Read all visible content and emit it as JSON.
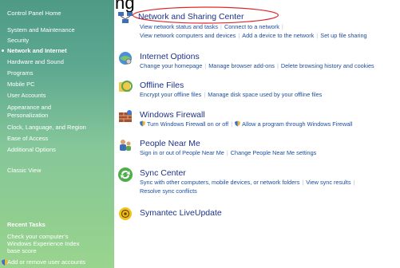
{
  "header": {
    "title": "ng"
  },
  "sidebar": {
    "items": [
      {
        "label": "Control Panel Home"
      },
      {
        "label": "System and Maintenance"
      },
      {
        "label": "Security"
      },
      {
        "label": "Network and Internet"
      },
      {
        "label": "Hardware and Sound"
      },
      {
        "label": "Programs"
      },
      {
        "label": "Mobile PC"
      },
      {
        "label": "User Accounts"
      },
      {
        "label": "Appearance and"
      },
      {
        "label": "Personalization"
      },
      {
        "label": "Clock, Language, and Region"
      },
      {
        "label": "Ease of Access"
      },
      {
        "label": "Additional Options"
      }
    ],
    "classic_view": "Classic View",
    "recent_tasks": {
      "heading": "Recent Tasks",
      "items": [
        {
          "label": "Check your computer's"
        },
        {
          "label": "Windows Experience Index"
        },
        {
          "label": "base score"
        },
        {
          "label": "Add or remove user accounts"
        }
      ]
    }
  },
  "categories": [
    {
      "title": "Network and Sharing Center",
      "icon": "network-icon",
      "links": [
        "View network status and tasks",
        "Connect to a network",
        "View network computers and devices",
        "Add a device to the network",
        "Set up file sharing"
      ]
    },
    {
      "title": "Internet Options",
      "icon": "internet-options-icon",
      "links": [
        "Change your homepage",
        "Manage browser add-ons",
        "Delete browsing history and cookies"
      ]
    },
    {
      "title": "Offline Files",
      "icon": "offline-files-icon",
      "links": [
        "Encrypt your offline files",
        "Manage disk space used by your offline files"
      ]
    },
    {
      "title": "Windows Firewall",
      "icon": "firewall-icon",
      "links": [
        "Turn Windows Firewall on or off",
        "Allow a program through Windows Firewall"
      ]
    },
    {
      "title": "People Near Me",
      "icon": "people-near-me-icon",
      "links": [
        "Sign in or out of People Near Me",
        "Change People Near Me settings"
      ]
    },
    {
      "title": "Sync Center",
      "icon": "sync-center-icon",
      "links": [
        "Sync with other computers, mobile devices, or network folders",
        "View sync results",
        "Resolve sync conflicts"
      ]
    },
    {
      "title": "Symantec LiveUpdate",
      "icon": "liveupdate-icon",
      "links": []
    }
  ],
  "colors": {
    "link": "#1d4da0",
    "title": "#1e3287",
    "highlight": "#e0282a",
    "sidebar_top": "#4f9a86",
    "sidebar_bottom": "#9ad58f"
  }
}
